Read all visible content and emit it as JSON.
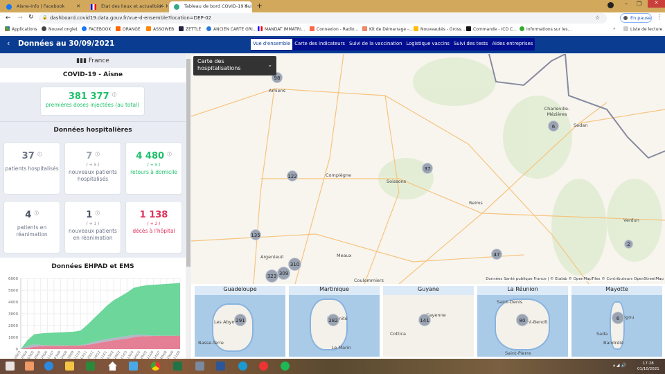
{
  "browser": {
    "tabs": [
      {
        "label": "Aisne-Info | Facebook"
      },
      {
        "label": "État des lieux et actualités - Mini"
      },
      {
        "label": "Tableau de bord COVID-19 Suivi"
      }
    ],
    "url": "dashboard.covid19.data.gouv.fr/vue-d-ensemble?location=DEP-02",
    "profile": "En pause",
    "bookmarks": [
      "Applications",
      "Nouvel onglet",
      "FACEBOOK",
      "ORANGE",
      "ASSOWEB",
      "ZETTLE",
      "ANCIEN CARTE GRI...",
      "MANDAT IMMATRI...",
      "Connexion - Radio...",
      "Kit de Démarrage -...",
      "Nouveautés - Gross...",
      "Commande - ICD C...",
      "Informations sur les..."
    ],
    "reading_list": "Liste de lecture"
  },
  "header": {
    "title": "Données au 30/09/2021",
    "tabs": [
      "Vue d'ensemble",
      "Carte des indicateurs",
      "Suivi de la vaccination",
      "Logistique vaccins",
      "Suivi des tests",
      "Aides entreprises"
    ],
    "active_tab": "Vue d'ensemble"
  },
  "left": {
    "country": "France",
    "location_title": "COVID-19 - Aisne",
    "vaccine": {
      "value": "381 377",
      "label": "premières doses injectées (au total)"
    },
    "hosp_title": "Données hospitalières",
    "cards": [
      {
        "value": "37",
        "delta": "",
        "label": "patients hospitalisés",
        "color": "#6b7486"
      },
      {
        "value": "7",
        "delta": "( + 5 )",
        "label": "nouveaux patients hospitalisés",
        "color": "#9aa1ae"
      },
      {
        "value": "4 480",
        "delta": "( + 5 )",
        "label": "retours à domicile",
        "color": "#1fc06b"
      },
      {
        "value": "4",
        "delta": "",
        "label": "patients en réanimation",
        "color": "#4a5365"
      },
      {
        "value": "1",
        "delta": "( + 1 )",
        "label": "nouveaux patients en réanimation",
        "color": "#4a5365"
      },
      {
        "value": "1 138",
        "delta": "( + 2 )",
        "label": "décès à l'hôpital",
        "color": "#e0305a"
      }
    ],
    "ehpad_title": "Données EHPAD et EMS"
  },
  "chart_data": {
    "type": "area",
    "stacked": true,
    "title": "",
    "xlabel": "",
    "ylabel": "",
    "ylim": [
      0,
      6000
    ],
    "grid": true,
    "yticks": [
      0,
      1000,
      2000,
      3000,
      4000,
      5000,
      6000
    ],
    "categories": [
      "18/03",
      "10/04",
      "03/05",
      "26/05",
      "18/06",
      "11/07",
      "03/08",
      "26/08",
      "18/09",
      "11/10",
      "03/11",
      "26/11",
      "19/12",
      "11/01",
      "03/02",
      "26/02",
      "21/03",
      "13/04",
      "06/05",
      "29/05",
      "21/06",
      "14/07",
      "06/08",
      "29/08",
      "21/09"
    ],
    "series": [
      {
        "color": "#e57f95",
        "values": [
          0,
          100,
          200,
          250,
          270,
          280,
          280,
          290,
          300,
          310,
          350,
          450,
          550,
          650,
          750,
          820,
          900,
          1000,
          1080,
          1100,
          1120,
          1130,
          1130,
          1135,
          1138
        ]
      },
      {
        "color": "#b3b7c6",
        "values": [
          0,
          150,
          200,
          100,
          60,
          40,
          30,
          20,
          10,
          30,
          100,
          150,
          200,
          200,
          200,
          200,
          200,
          200,
          150,
          80,
          20,
          10,
          5,
          5,
          5
        ]
      },
      {
        "color": "#6dd69b",
        "values": [
          0,
          500,
          850,
          980,
          1040,
          1080,
          1110,
          1140,
          1170,
          1230,
          1600,
          2000,
          2400,
          2850,
          3200,
          3450,
          3700,
          4000,
          4100,
          4250,
          4320,
          4360,
          4400,
          4430,
          4470
        ]
      }
    ]
  },
  "map": {
    "selector": "Carte des hospitalisations",
    "attribution": "Données Santé publique France | © Etalab © OpenMapTiles © Contributeurs OpenStreetMap",
    "cities": [
      "Amiens",
      "Compiègne",
      "Soissons",
      "Reims",
      "Charleville-Mézières",
      "Sedan",
      "Verdun",
      "Argenteuil",
      "Meaux",
      "Coulommiers"
    ],
    "clusters": [
      "98",
      "122",
      "37",
      "6",
      "135",
      "310",
      "309",
      "323",
      "47",
      "2"
    ],
    "overseas": [
      {
        "name": "Guadeloupe",
        "count": "291",
        "cities": [
          "Les Abymes",
          "Basse-Terre"
        ]
      },
      {
        "name": "Martinique",
        "count": "282",
        "cities": [
          "La Trinité",
          "Le Marin"
        ]
      },
      {
        "name": "Guyane",
        "count": "141",
        "cities": [
          "Cayenne",
          "Cottica"
        ]
      },
      {
        "name": "La Réunion",
        "count": "80",
        "cities": [
          "Saint-Denis",
          "Saint-Benoît",
          "Saint-Pierre"
        ]
      },
      {
        "name": "Mayotte",
        "count": "6",
        "cities": [
          "Koungou",
          "Sada",
          "Bandrélé"
        ]
      }
    ]
  },
  "taskbar": {
    "time": "17:28",
    "date": "01/10/2021"
  }
}
